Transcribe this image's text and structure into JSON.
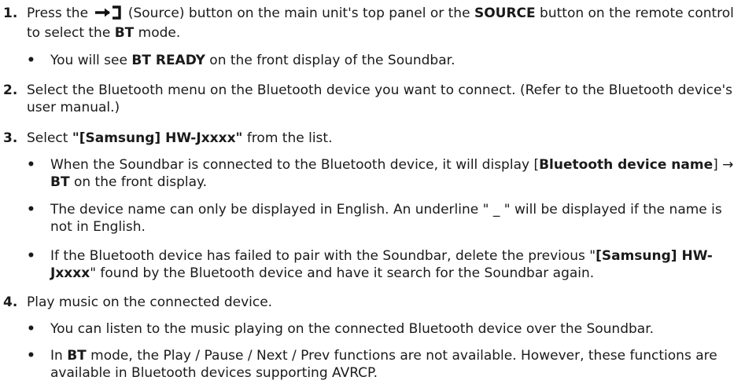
{
  "steps": [
    {
      "num": "1.",
      "parts": [
        "Press the ",
        " (Source) button on the main unit's top panel or the ",
        "SOURCE",
        " button on the remote control to select the ",
        "BT",
        " mode."
      ],
      "icon": "source-icon",
      "bullets": [
        {
          "parts": [
            "You will see ",
            "BT READY",
            " on the front display of the Soundbar."
          ]
        }
      ]
    },
    {
      "num": "2.",
      "text": "Select the Bluetooth menu on the Bluetooth device you want to connect. (Refer to the Bluetooth device's user manual.)"
    },
    {
      "num": "3.",
      "parts": [
        "Select ",
        "\"[Samsung] HW-Jxxxx\"",
        " from the list."
      ],
      "bullets": [
        {
          "parts": [
            "When the Soundbar is connected to the Bluetooth device, it will display [",
            "Bluetooth device name",
            "] → ",
            "BT",
            " on the front display."
          ]
        },
        {
          "text": "The device name can only be displayed in English. An underline \" _ \" will be displayed if the name is not in English."
        },
        {
          "parts": [
            "If the Bluetooth device has failed to pair with the Soundbar, delete the previous \"",
            "[Samsung] HW-Jxxxx",
            "\" found by the Bluetooth device and have it search for the Soundbar again."
          ]
        }
      ]
    },
    {
      "num": "4.",
      "text": "Play music on the connected device.",
      "bullets": [
        {
          "text": "You can listen to the music playing on the connected Bluetooth device over the Soundbar."
        },
        {
          "parts": [
            "In ",
            "BT",
            " mode, the Play / Pause / Next / Prev functions are not available. However, these functions are available in Bluetooth devices supporting AVRCP."
          ]
        }
      ]
    }
  ],
  "bullet_char": "•"
}
